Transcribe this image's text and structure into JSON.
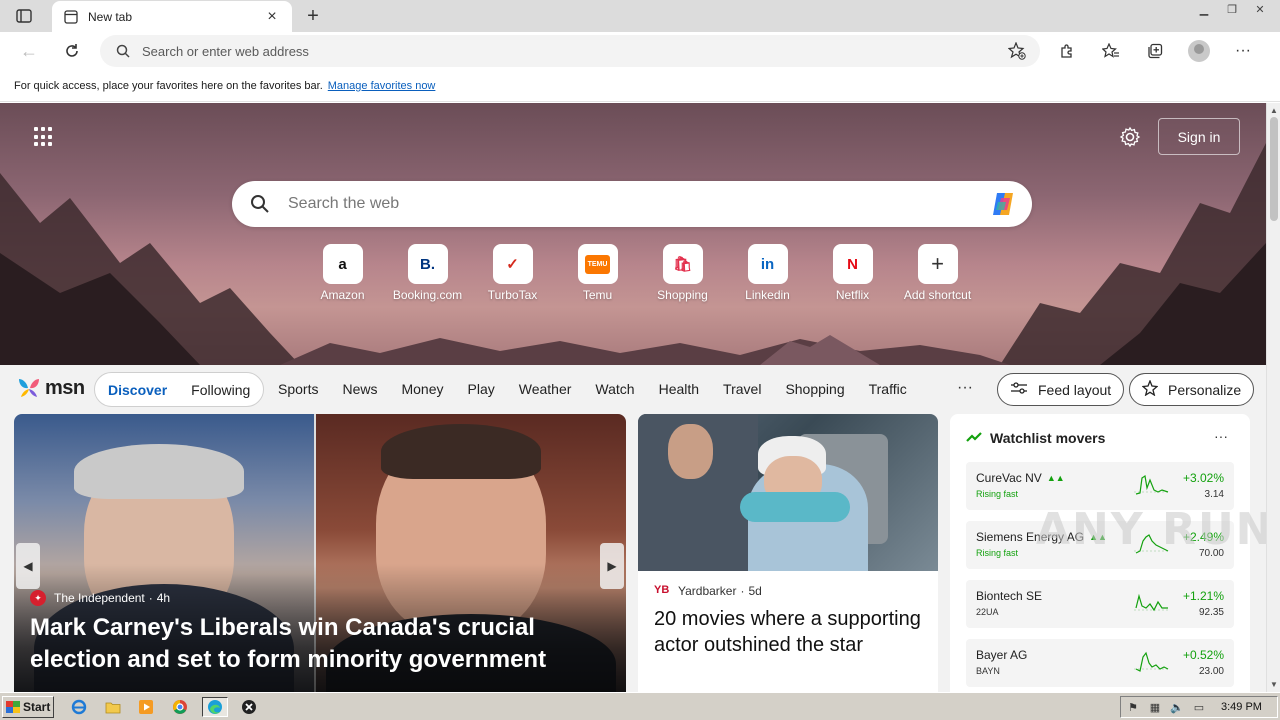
{
  "browser": {
    "tab_title": "New tab",
    "address_placeholder": "Search or enter web address",
    "favorites_text": "For quick access, place your favorites here on the favorites bar.",
    "favorites_link": "Manage favorites now"
  },
  "newtab": {
    "sign_in": "Sign in",
    "search_placeholder": "Search the web",
    "shortcuts": [
      {
        "label": "Amazon",
        "glyph": "a",
        "color": "#111111"
      },
      {
        "label": "Booking.com",
        "glyph": "B.",
        "color": "#003580"
      },
      {
        "label": "TurboTax",
        "glyph": "✓",
        "color": "#d52b1e"
      },
      {
        "label": "Temu",
        "glyph": "TEMU",
        "color": "#fb7701"
      },
      {
        "label": "Shopping",
        "glyph": "🛍",
        "color": "#e3304d"
      },
      {
        "label": "Linkedin",
        "glyph": "in",
        "color": "#0a66c2"
      },
      {
        "label": "Netflix",
        "glyph": "N",
        "color": "#e50914"
      },
      {
        "label": "Add shortcut",
        "glyph": "+",
        "color": "#333333"
      }
    ]
  },
  "msn": {
    "wordmark": "msn",
    "primary_tabs": [
      "Discover",
      "Following"
    ],
    "nav_links": [
      "Sports",
      "News",
      "Money",
      "Play",
      "Weather",
      "Watch",
      "Health",
      "Travel",
      "Shopping",
      "Traffic"
    ],
    "more": "···",
    "feed_layout": "Feed layout",
    "personalize": "Personalize"
  },
  "hero_story": {
    "source": "The Independent",
    "age": "4h",
    "title": "Mark Carney's Liberals win Canada's crucial election and set to form minority government"
  },
  "mid_story": {
    "source": "Yardbarker",
    "age": "5d",
    "title": "20 movies where a supporting actor outshined the star"
  },
  "watchlist": {
    "title": "Watchlist movers",
    "stocks": [
      {
        "name": "CureVac NV",
        "sub": "Rising fast",
        "change": "+3.02%",
        "price": "3.14",
        "rising": true
      },
      {
        "name": "Siemens Energy AG",
        "sub": "Rising fast",
        "change": "+2.49%",
        "price": "70.00",
        "rising": true
      },
      {
        "name": "Biontech SE",
        "sub": "22UA",
        "change": "+1.21%",
        "price": "92.35",
        "rising": false
      },
      {
        "name": "Bayer AG",
        "sub": "BAYN",
        "change": "+0.52%",
        "price": "23.00",
        "rising": false
      }
    ]
  },
  "watermark": "ANY RUN",
  "taskbar": {
    "start": "Start",
    "clock": "3:49 PM"
  }
}
